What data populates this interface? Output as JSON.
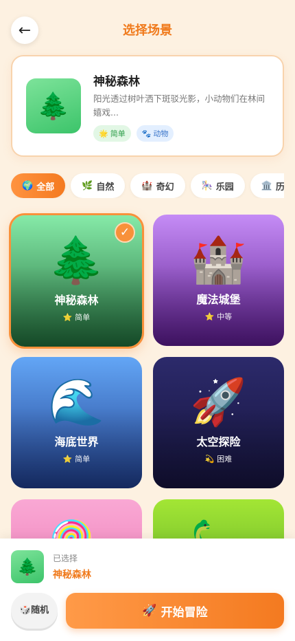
{
  "header": {
    "back_icon": "←",
    "title": "选择场景"
  },
  "preview": {
    "icon": "🌲",
    "name": "神秘森林",
    "description": "阳光透过树叶洒下斑驳光影，小动物们在林间嬉戏...",
    "tags": [
      {
        "icon": "🌟",
        "label": "简单"
      },
      {
        "icon": "🐾",
        "label": "动物"
      }
    ]
  },
  "categories": [
    {
      "icon": "🌍",
      "label": "全部",
      "active": true
    },
    {
      "icon": "🌿",
      "label": "自然",
      "active": false
    },
    {
      "icon": "🏰",
      "label": "奇幻",
      "active": false
    },
    {
      "icon": "🎠",
      "label": "乐园",
      "active": false
    },
    {
      "icon": "🏛️",
      "label": "历史",
      "active": false
    }
  ],
  "scenes": [
    {
      "icon": "🌲",
      "name": "神秘森林",
      "level_icon": "⭐",
      "level": "简单",
      "selected": true,
      "color_top": "#86eaa8",
      "color_bottom": "#1f6b39"
    },
    {
      "icon": "🏰",
      "name": "魔法城堡",
      "level_icon": "⭐",
      "level": "中等",
      "selected": false,
      "color_top": "#c58cf6",
      "color_bottom": "#5a1a8c"
    },
    {
      "icon": "🌊",
      "name": "海底世界",
      "level_icon": "⭐",
      "level": "简单",
      "selected": false,
      "color_top": "#63a6f6",
      "color_bottom": "#1e3c8a"
    },
    {
      "icon": "🚀",
      "name": "太空探险",
      "level_icon": "💫",
      "level": "困难",
      "selected": false,
      "color_top": "#2c2a6b",
      "color_bottom": "#15133c"
    },
    {
      "icon": "🍭",
      "name": "",
      "level_icon": "",
      "level": "",
      "selected": false,
      "color_top": "#f9a8d4",
      "color_bottom": "#ec6fae"
    },
    {
      "icon": "🦕",
      "name": "",
      "level_icon": "",
      "level": "",
      "selected": false,
      "color_top": "#a3e635",
      "color_bottom": "#4d9a22"
    }
  ],
  "selected_panel": {
    "label": "已选择",
    "icon": "🌲",
    "name": "神秘森林"
  },
  "actions": {
    "random_icon": "🎲",
    "random_label": "随机",
    "start_icon": "🚀",
    "start_label": "开始冒险"
  }
}
